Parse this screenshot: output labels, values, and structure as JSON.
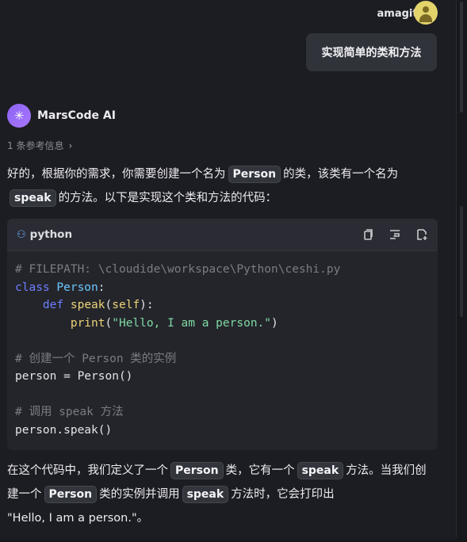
{
  "user": {
    "name": "amagittt"
  },
  "user_message": "实现简单的类和方法",
  "assistant": {
    "name": "MarsCode AI"
  },
  "reference": {
    "label": "1 条参考信息"
  },
  "intro": {
    "t1": "好的，根据你的需求，你需要创建一个名为",
    "c1": "Person",
    "t2": "的类，该类有一个名为",
    "c2": "speak",
    "t3": "的方法。以下是实现这个类和方法的代码："
  },
  "code_block": {
    "language": "python",
    "lines": {
      "l1": "# FILEPATH: \\cloudide\\workspace\\Python\\ceshi.py",
      "l2_kw": "class",
      "l2_name": "Person",
      "l3_kw": "def",
      "l3_fn": "speak",
      "l3_self": "self",
      "l4_fn": "print",
      "l4_str": "\"Hello, I am a person.\"",
      "l6": "# 创建一个 Person 类的实例",
      "l7": "person = Person()",
      "l9": "# 调用 speak 方法",
      "l10": "person.speak()"
    }
  },
  "outro": {
    "t1": "在这个代码中，我们定义了一个",
    "c1": "Person",
    "t2": "类，它有一个",
    "c2": "speak",
    "t3": "方法。当我们创建一个",
    "c3": "Person",
    "t4": "类的实例并调用",
    "c4": "speak",
    "t5": "方法时，它会打印出",
    "t6": "\"Hello, I am a person.\"。"
  },
  "colors": {
    "accent": "#8c63f2",
    "avatar": "#e3d36b",
    "background": "#1c1d22"
  }
}
